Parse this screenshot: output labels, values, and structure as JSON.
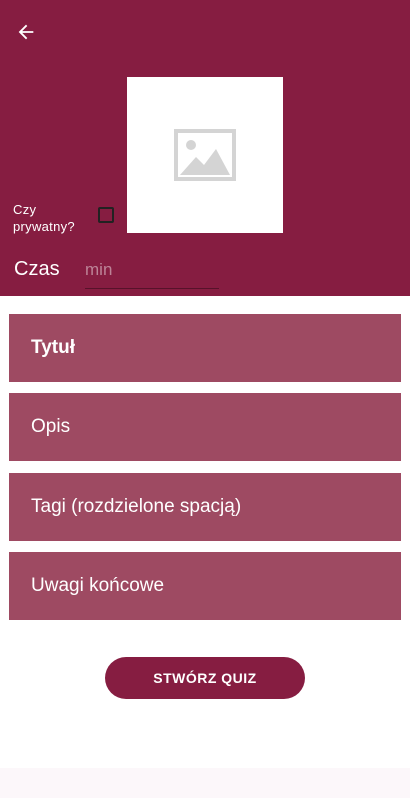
{
  "header": {
    "back_icon": "arrow-back-icon",
    "image_icon": "image-placeholder-icon",
    "private_label": "Czy prywatny?",
    "private_checked": false,
    "time_label": "Czas",
    "time_placeholder": "min",
    "time_value": ""
  },
  "fields": {
    "title": "Tytuł",
    "description": "Opis",
    "tags": "Tagi (rozdzielone spacją)",
    "final_notes": "Uwagi końcowe"
  },
  "actions": {
    "create_label": "STWÓRZ QUIZ"
  },
  "colors": {
    "primary": "#861d41",
    "field_bg": "#9e4a62"
  }
}
